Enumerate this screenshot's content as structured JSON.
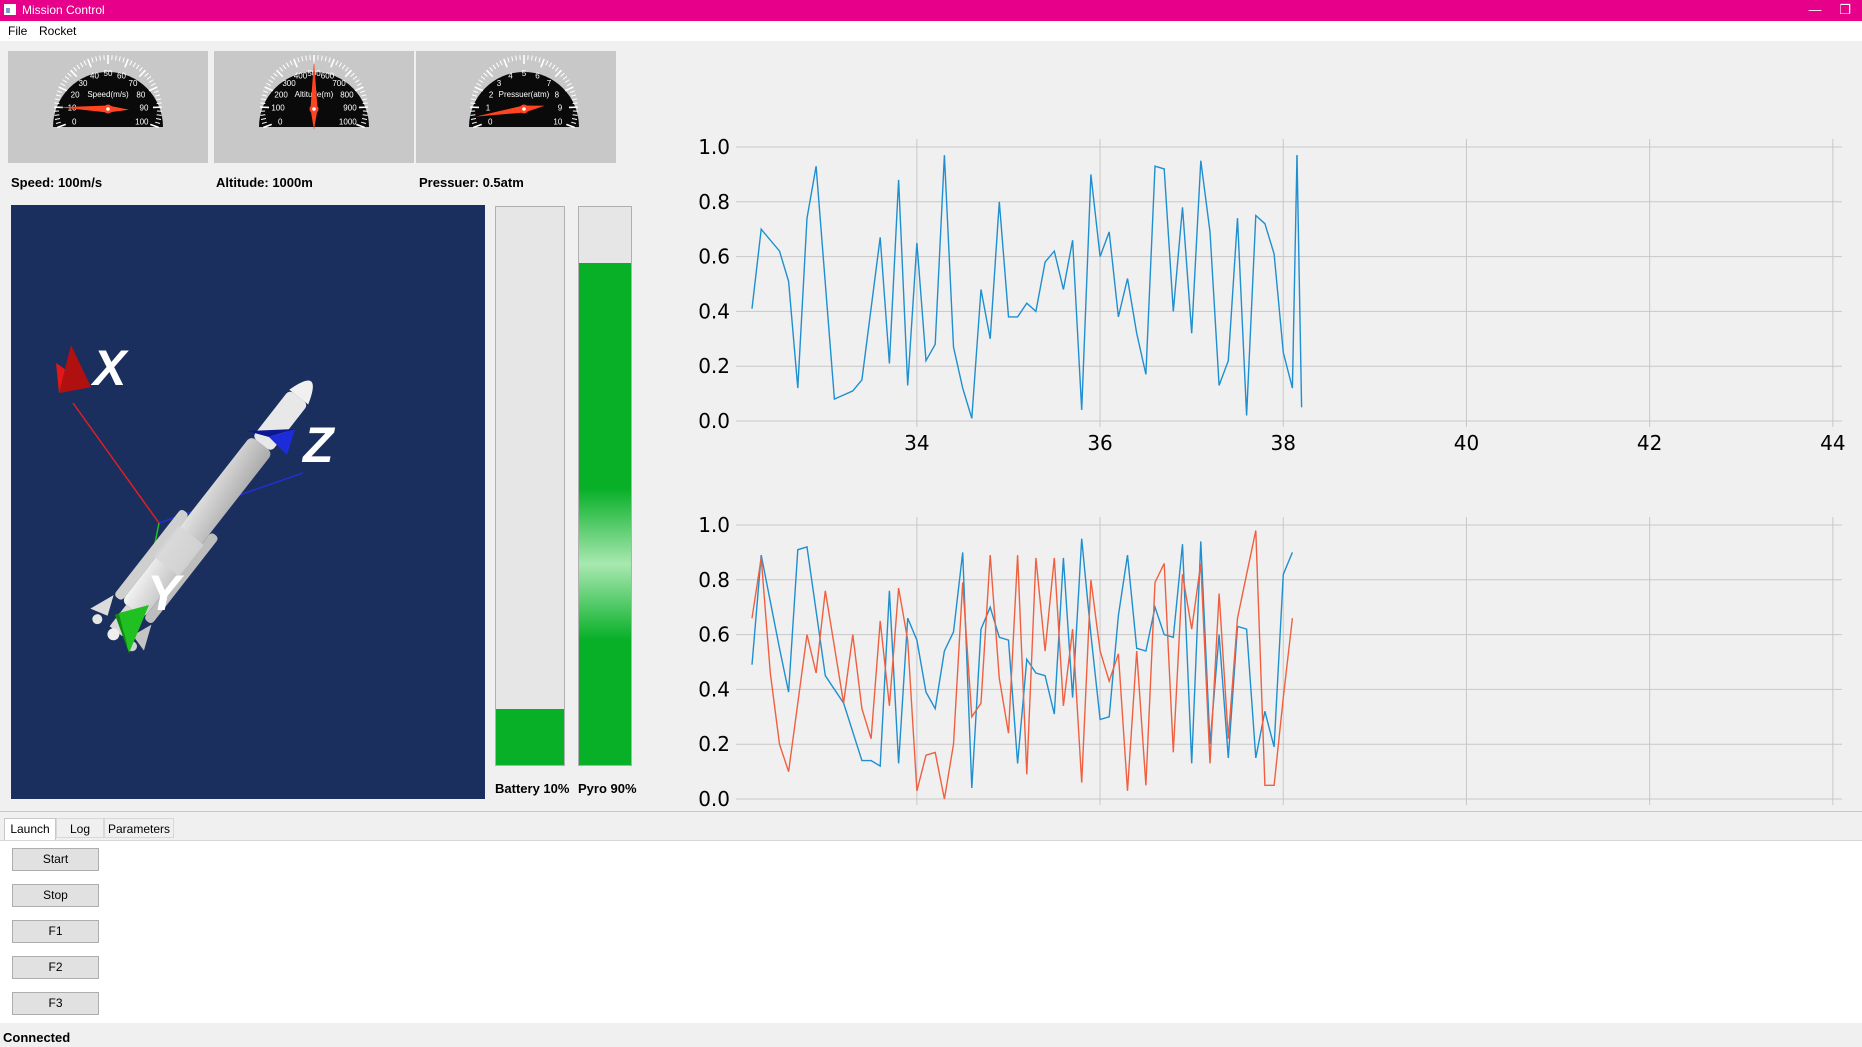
{
  "window": {
    "title": "Mission Control",
    "minimize_symbol": "—",
    "restore_symbol": "❐"
  },
  "menu": {
    "items": [
      "File",
      "Rocket"
    ]
  },
  "gauges": [
    {
      "name": "speed",
      "dial_label": "Speed(m/s)",
      "ticks": [
        "0",
        "10",
        "20",
        "30",
        "40",
        "50",
        "60",
        "70",
        "80",
        "90",
        "100"
      ],
      "value_fraction": 0.1,
      "readout": "Speed: 100m/s"
    },
    {
      "name": "altitude",
      "dial_label": "Altitude(m)",
      "ticks": [
        "0",
        "100",
        "200",
        "300",
        "400",
        "500",
        "600",
        "700",
        "800",
        "900",
        "1000"
      ],
      "value_fraction": 0.5,
      "readout": "Altitude: 1000m"
    },
    {
      "name": "pressure",
      "dial_label": "Pressuer(atm)",
      "ticks": [
        "0",
        "1",
        "2",
        "3",
        "4",
        "5",
        "6",
        "7",
        "8",
        "9",
        "10"
      ],
      "value_fraction": 0.05,
      "readout": "Pressuer: 0.5atm"
    }
  ],
  "rocket_view": {
    "axis_labels": {
      "x": "X",
      "y": "Y",
      "z": "Z"
    },
    "background": "#1a2f5e",
    "axis_colors": {
      "x": "#e02020",
      "y": "#20c020",
      "z": "#2020e0"
    }
  },
  "bars": [
    {
      "name": "battery",
      "label": "Battery 10%",
      "fraction": 0.1,
      "color": "#08b028"
    },
    {
      "name": "pyro",
      "label": "Pyro 90%",
      "fraction": 0.9,
      "color": "#08b028"
    }
  ],
  "tabs": [
    {
      "label": "Launch",
      "active": true
    },
    {
      "label": "Log",
      "active": false
    },
    {
      "label": "Parameters",
      "active": false
    }
  ],
  "buttons": [
    "Start",
    "Stop",
    "F1",
    "F2",
    "F3"
  ],
  "status": "Connected",
  "chart_data": [
    {
      "type": "line",
      "xlim": [
        32.2,
        44.1
      ],
      "ylim": [
        0,
        1.0
      ],
      "xticks": [
        "34",
        "36",
        "38",
        "40",
        "42",
        "44"
      ],
      "yticks": [
        "0.0",
        "0.2",
        "0.4",
        "0.6",
        "0.8",
        "1.0"
      ],
      "grid": true,
      "series": [
        {
          "color": "#1f8fcf",
          "x": [
            32.2,
            32.3,
            32.5,
            32.6,
            32.7,
            32.8,
            32.9,
            33.1,
            33.3,
            33.4,
            33.6,
            33.7,
            33.8,
            33.9,
            34.0,
            34.1,
            34.2,
            34.3,
            34.4,
            34.5,
            34.6,
            34.7,
            34.8,
            34.9,
            35.0,
            35.1,
            35.2,
            35.3,
            35.4,
            35.5,
            35.6,
            35.7,
            35.8,
            35.9,
            36.0,
            36.1,
            36.2,
            36.3,
            36.4,
            36.5,
            36.6,
            36.7,
            36.8,
            36.9,
            37.0,
            37.1,
            37.2,
            37.3,
            37.4,
            37.5,
            37.6,
            37.7,
            37.8,
            37.9,
            38.0,
            38.1,
            38.15
          ],
          "y": [
            0.41,
            0.7,
            0.62,
            0.51,
            0.12,
            0.74,
            0.93,
            0.08,
            0.11,
            0.15,
            0.67,
            0.21,
            0.88,
            0.13,
            0.65,
            0.22,
            0.28,
            0.97,
            0.27,
            0.12,
            0.01,
            0.48,
            0.3,
            0.8,
            0.38,
            0.38,
            0.43,
            0.4,
            0.58,
            0.62,
            0.48,
            0.66,
            0.04,
            0.9,
            0.6,
            0.69,
            0.38,
            0.52,
            0.32,
            0.17,
            0.93,
            0.92,
            0.4,
            0.78,
            0.32,
            0.95,
            0.69,
            0.13,
            0.22,
            0.74,
            0.02,
            0.75,
            0.72,
            0.61,
            0.25,
            0.12,
            0.97
          ]
        },
        {
          "color": "#1f8fcf",
          "x": [
            38.15,
            38.2
          ],
          "y": [
            0.97,
            0.05
          ]
        }
      ]
    },
    {
      "type": "line",
      "xlim": [
        32.2,
        44.1
      ],
      "ylim": [
        0,
        1.0
      ],
      "xticks": [
        "34",
        "36",
        "38",
        "40",
        "42",
        "44"
      ],
      "yticks": [
        "0.0",
        "0.2",
        "0.4",
        "0.6",
        "0.8",
        "1.0"
      ],
      "grid": true,
      "series": [
        {
          "color": "#1f8fcf",
          "x": [
            32.2,
            32.3,
            32.5,
            32.6,
            32.7,
            32.8,
            33.0,
            33.2,
            33.4,
            33.5,
            33.6,
            33.7,
            33.8,
            33.9,
            34.0,
            34.1,
            34.2,
            34.3,
            34.4,
            34.5,
            34.6,
            34.7,
            34.8,
            34.9,
            35.0,
            35.1,
            35.2,
            35.3,
            35.4,
            35.5,
            35.6,
            35.7,
            35.8,
            35.9,
            36.0,
            36.1,
            36.2,
            36.3,
            36.4,
            36.5,
            36.6,
            36.7,
            36.8,
            36.9,
            37.0,
            37.1,
            37.2,
            37.3,
            37.4,
            37.5,
            37.6,
            37.7,
            37.8,
            37.9,
            38.0,
            38.1
          ],
          "y": [
            0.49,
            0.89,
            0.55,
            0.39,
            0.91,
            0.92,
            0.45,
            0.35,
            0.14,
            0.14,
            0.12,
            0.76,
            0.13,
            0.66,
            0.58,
            0.39,
            0.33,
            0.54,
            0.61,
            0.9,
            0.04,
            0.62,
            0.7,
            0.59,
            0.58,
            0.13,
            0.51,
            0.46,
            0.45,
            0.31,
            0.88,
            0.37,
            0.95,
            0.6,
            0.29,
            0.3,
            0.67,
            0.89,
            0.55,
            0.54,
            0.7,
            0.6,
            0.59,
            0.93,
            0.13,
            0.94,
            0.2,
            0.6,
            0.15,
            0.63,
            0.62,
            0.15,
            0.32,
            0.19,
            0.82,
            0.9
          ]
        },
        {
          "color": "#f06040",
          "x": [
            32.2,
            32.3,
            32.4,
            32.5,
            32.6,
            32.8,
            32.9,
            33.0,
            33.2,
            33.3,
            33.4,
            33.5,
            33.6,
            33.7,
            33.8,
            33.9,
            34.0,
            34.1,
            34.2,
            34.3,
            34.4,
            34.5,
            34.6,
            34.7,
            34.8,
            34.9,
            35.0,
            35.1,
            35.2,
            35.3,
            35.4,
            35.5,
            35.6,
            35.7,
            35.8,
            35.9,
            36.0,
            36.1,
            36.2,
            36.3,
            36.4,
            36.5,
            36.6,
            36.7,
            36.8,
            36.9,
            37.0,
            37.1,
            37.2,
            37.3,
            37.4,
            37.5,
            37.6,
            37.7,
            37.8,
            37.9,
            38.0,
            38.1
          ],
          "y": [
            0.66,
            0.88,
            0.46,
            0.2,
            0.1,
            0.6,
            0.46,
            0.76,
            0.35,
            0.6,
            0.33,
            0.22,
            0.65,
            0.34,
            0.77,
            0.58,
            0.03,
            0.16,
            0.17,
            0.0,
            0.2,
            0.79,
            0.3,
            0.35,
            0.89,
            0.44,
            0.24,
            0.89,
            0.09,
            0.88,
            0.54,
            0.88,
            0.34,
            0.62,
            0.06,
            0.8,
            0.54,
            0.43,
            0.53,
            0.03,
            0.54,
            0.05,
            0.79,
            0.86,
            0.17,
            0.82,
            0.62,
            0.86,
            0.13,
            0.75,
            0.22,
            0.66,
            0.82,
            0.98,
            0.05,
            0.05,
            0.37,
            0.66
          ]
        }
      ]
    }
  ]
}
